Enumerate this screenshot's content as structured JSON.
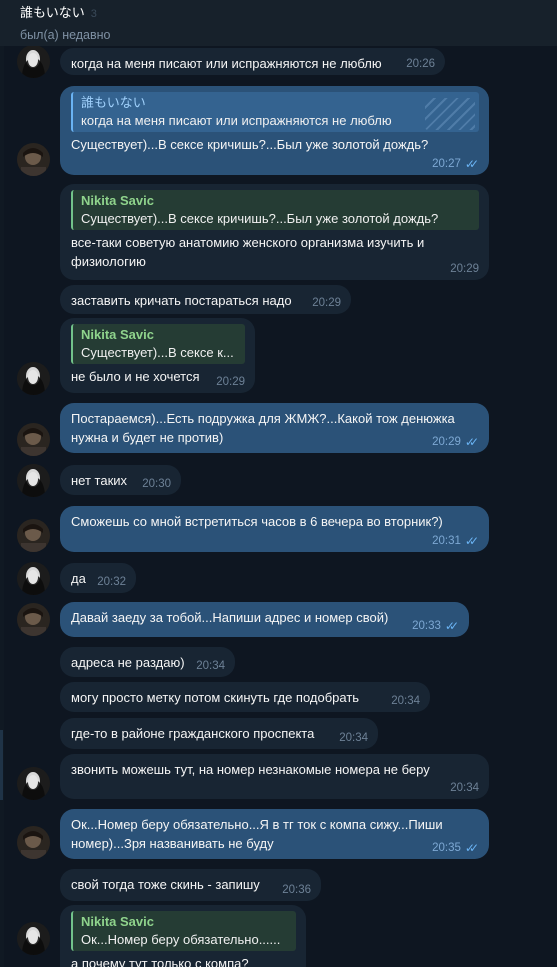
{
  "header": {
    "title": "誰もいない",
    "muted_count": "3",
    "status": "был(а) недавно"
  },
  "messages": [
    {
      "text": "когда на меня писают или испражняются не люблю",
      "time": "20:26"
    },
    {
      "reply_name": "誰もいない",
      "reply_text": "когда на меня писают или испражняются не люблю",
      "text": "Существует)...В сексе кричишь?...Был уже золотой дождь?",
      "time": "20:27"
    },
    {
      "reply_name": "Nikita Savic",
      "reply_text": "Существует)...В сексе кричишь?...Был уже золотой дождь?",
      "text": "все-таки советую анатомию женского организма изучить и физиологию",
      "time": "20:29"
    },
    {
      "text": "заставить кричать постараться надо",
      "time": "20:29"
    },
    {
      "reply_name": "Nikita Savic",
      "reply_text": "Существует)...В сексе к...",
      "text": "не было и не хочется",
      "time": "20:29"
    },
    {
      "text": "Постараемся)...Есть подружка для ЖМЖ?...Какой тож денюжка нужна и будет не против)",
      "time": "20:29"
    },
    {
      "text": "нет таких",
      "time": "20:30"
    },
    {
      "text": "Сможешь со мной встретиться часов в 6 вечера во вторник?)",
      "time": "20:31"
    },
    {
      "text": "да",
      "time": "20:32"
    },
    {
      "text": "Давай заеду за тобой...Напиши адрес и номер свой)",
      "time": "20:33"
    },
    {
      "text": "адреса не раздаю)",
      "time": "20:34"
    },
    {
      "text": "могу просто метку потом скинуть где подобрать",
      "time": "20:34"
    },
    {
      "text": "где-то в районе гражданского проспекта",
      "time": "20:34"
    },
    {
      "text": "звонить можешь тут, на номер незнакомые номера не беру",
      "time": "20:34"
    },
    {
      "text": "Ок...Номер беру обязательно...Я в тг ток с компа сижу...Пиши номер)...Зря названивать не буду",
      "time": "20:35"
    },
    {
      "text": "свой тогда тоже скинь - запишу",
      "time": "20:36"
    },
    {
      "reply_name": "Nikita Savic",
      "reply_text": "Ок...Номер беру обязательно......",
      "text": "а почему тут только с компа?"
    }
  ],
  "ticks_glyph": "✓✓",
  "colors": {
    "background": "#0e1621",
    "incoming": "#182533",
    "outgoing": "#2b5278",
    "accent": "#6ab3f3",
    "reply_name_in": "#8fd38c"
  }
}
